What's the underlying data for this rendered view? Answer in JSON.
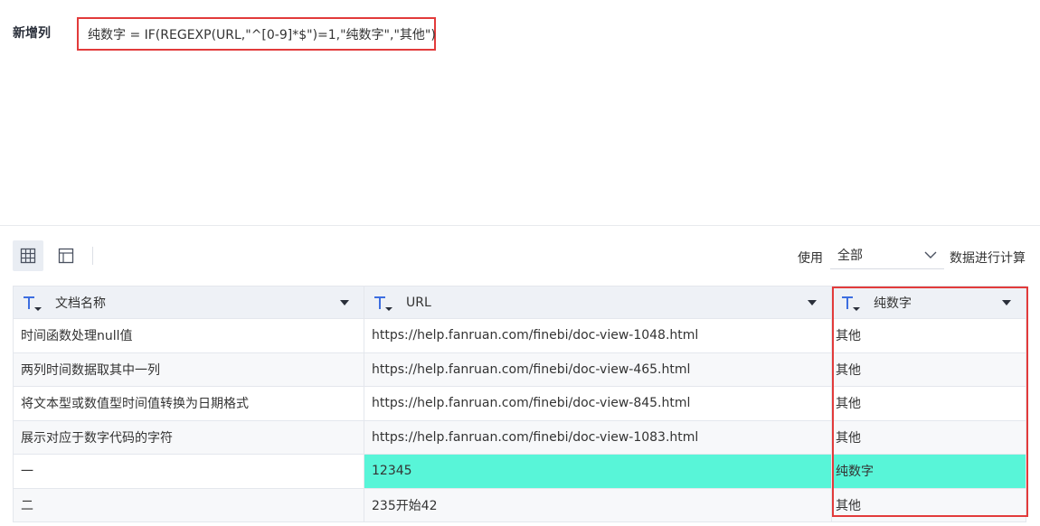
{
  "formula": {
    "label": "新增列",
    "expression": "纯数字 = IF(REGEXP(URL,\"^[0-9]*$\")=1,\"纯数字\",\"其他\")"
  },
  "toolbar": {
    "views": [
      {
        "name": "table-view",
        "icon": "grid-icon",
        "active": true
      },
      {
        "name": "panel-view",
        "icon": "layout-icon",
        "active": false
      }
    ],
    "use_label": "使用",
    "scope_value": "全部",
    "after_label": "数据进行计算"
  },
  "table": {
    "columns": [
      {
        "label": "文档名称",
        "type_icon": "text-type-icon"
      },
      {
        "label": "URL",
        "type_icon": "text-type-icon"
      },
      {
        "label": "纯数字",
        "type_icon": "text-type-icon"
      }
    ],
    "rows": [
      [
        "时间函数处理null值",
        "https://help.fanruan.com/finebi/doc-view-1048.html",
        "其他"
      ],
      [
        "两列时间数据取其中一列",
        "https://help.fanruan.com/finebi/doc-view-465.html",
        "其他"
      ],
      [
        "将文本型或数值型时间值转换为日期格式",
        "https://help.fanruan.com/finebi/doc-view-845.html",
        "其他"
      ],
      [
        "展示对应于数字代码的字符",
        "https://help.fanruan.com/finebi/doc-view-1083.html",
        "其他"
      ],
      [
        "一",
        "12345",
        "纯数字"
      ],
      [
        "二",
        "235开始42",
        "其他"
      ]
    ],
    "highlight_row": 4
  },
  "colors": {
    "accent": "#3d6ee0",
    "highlight": "#58f5d8",
    "outline": "#e23b3b"
  }
}
